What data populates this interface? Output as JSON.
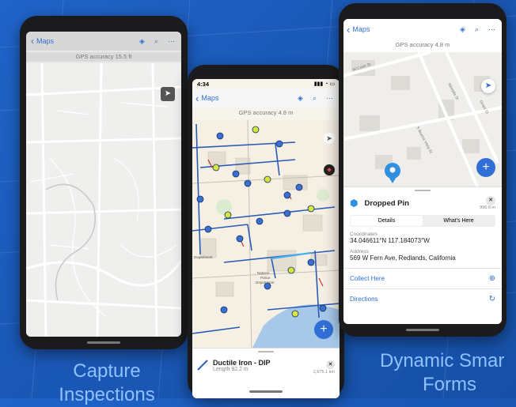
{
  "captions": {
    "left": [
      "Capture",
      "Inspections"
    ],
    "right": [
      "Dynamic Smar",
      "Forms"
    ]
  },
  "phone1": {
    "back": "Maps",
    "gps": "GPS accuracy 15.5 ft"
  },
  "phone2": {
    "status_time": "4:34",
    "back": "Maps",
    "gps": "GPS accuracy 4.8 m",
    "map_labels": [
      "Department",
      "Nations",
      "Police",
      "Department"
    ],
    "card": {
      "title": "Ductile Iron - DIP",
      "subtitle": "Length 92.2 m",
      "distance": "2,675.1 km"
    }
  },
  "phone3": {
    "back": "Maps",
    "gps": "GPS accuracy 4.8 m",
    "streets": [
      "W Cook St",
      "S Buena Vista St",
      "Grant St",
      "Nevada St"
    ],
    "panel": {
      "title": "Dropped Pin",
      "distance": "996.6 m",
      "tabs": [
        "Details",
        "What's Here"
      ],
      "coords_label": "Coordinates",
      "coords": "34.046611°N  117.184073°W",
      "address_label": "Address",
      "address": "569 W Fern Ave, Redlands, California",
      "collect": "Collect Here",
      "directions": "Directions"
    }
  },
  "colors": {
    "accent": "#2f6fd6",
    "pipe": "#2a5bb5",
    "valve": "#3a6fcf",
    "bg": "#1f63c8"
  }
}
